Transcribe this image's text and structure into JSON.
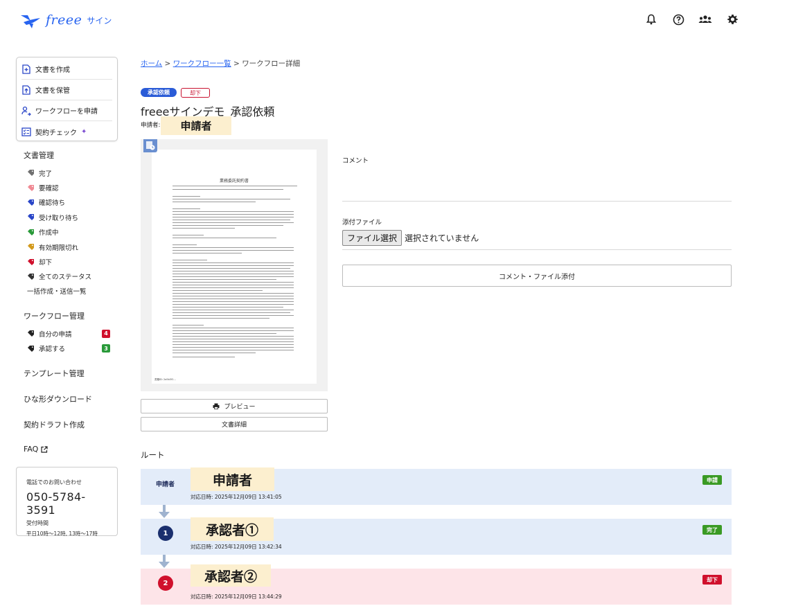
{
  "brand": {
    "logo_text": "freee",
    "logo_sub": "サイン"
  },
  "header_icons": [
    "bell-icon",
    "help-circle-icon",
    "team-icon",
    "gear-icon"
  ],
  "sidebar": {
    "quick_actions": [
      {
        "label": "文書を作成",
        "icon": "doc-plus-icon"
      },
      {
        "label": "文書を保管",
        "icon": "doc-upload-icon"
      },
      {
        "label": "ワークフローを申請",
        "icon": "user-flow-icon"
      },
      {
        "label": "契約チェック",
        "icon": "checklist-icon"
      }
    ],
    "doc_mgmt_heading": "文書管理",
    "doc_statuses": [
      {
        "label": "完了",
        "color": "#707070"
      },
      {
        "label": "要確認",
        "color": "#f08a94"
      },
      {
        "label": "確認待ち",
        "color": "#2a46c8"
      },
      {
        "label": "受け取り待ち",
        "color": "#2a46c8"
      },
      {
        "label": "作成中",
        "color": "#2a9a3a"
      },
      {
        "label": "有効期限切れ",
        "color": "#d39a1c"
      },
      {
        "label": "却下",
        "color": "#d0102c"
      },
      {
        "label": "全てのステータス",
        "color": "#333333"
      }
    ],
    "bulk_label": "一括作成・送信一覧",
    "workflow_heading": "ワークフロー管理",
    "workflow_items": [
      {
        "label": "自分の申請",
        "count": "4",
        "count_color": "#d0102c"
      },
      {
        "label": "承認する",
        "count": "3",
        "count_color": "#2a9a3a"
      }
    ],
    "template_label": "テンプレート管理",
    "hinagata_label": "ひな形ダウンロード",
    "draft_label": "契約ドラフト作成",
    "faq_label": "FAQ",
    "contact": {
      "label": "電話でのお問い合わせ",
      "phone": "050-5784-3591",
      "hours_label": "受付時間",
      "hours": "平日10時〜12時, 13時〜17時"
    }
  },
  "breadcrumb": {
    "home": "ホーム",
    "list": "ワークフロー一覧",
    "current": "ワークフロー詳細",
    "sep": ">"
  },
  "badges": {
    "request": "承認依頼",
    "rejected": "却下"
  },
  "doc_title": "freeeサインデモ_承認依頼",
  "applicant_label": "申請者:",
  "applicant_name": "申請者",
  "preview": {
    "doc_heading": "業務委託契約書",
    "footer_id": "書類ID: 2a5b3f1...",
    "preview_button": "プレビュー",
    "detail_button": "文書詳細"
  },
  "comment_label": "コメント",
  "attach_label": "添付ファイル",
  "file_button": "ファイル選択",
  "file_none": "選択されていません",
  "submit_button": "コメント・ファイル添付",
  "route": {
    "title": "ルート",
    "steps": [
      {
        "role": "申請者",
        "name": "申請者",
        "time": "対応日時: 2025年12月09日 13:41:05",
        "status": "申請",
        "status_color": "#3a9a24"
      },
      {
        "step": "1",
        "name": "承認者①",
        "time": "対応日時: 2025年12月09日 13:42:34",
        "status": "完了",
        "status_color": "#3a9a24"
      },
      {
        "step": "2",
        "name": "承認者②",
        "time": "対応日時: 2025年12月09日 13:44:29",
        "status": "却下",
        "status_color": "#d0102c"
      }
    ]
  }
}
